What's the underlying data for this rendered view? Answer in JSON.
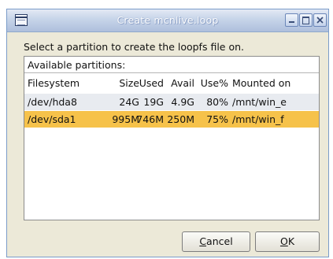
{
  "window": {
    "title": "Create mcnlive.loop"
  },
  "dialog": {
    "instruction": "Select a partition to create the loopfs file on.",
    "list_title": "Available partitions:",
    "columns": {
      "filesystem": "Filesystem",
      "size": "Size",
      "used": "Used",
      "avail": "Avail",
      "use_pct": "Use%",
      "mounted_on": "Mounted on"
    },
    "rows": [
      {
        "filesystem": "/dev/hda8",
        "size": "24G",
        "used": "19G",
        "avail": "4.9G",
        "use_pct": "80%",
        "mounted_on": "/mnt/win_e",
        "selected": false
      },
      {
        "filesystem": "/dev/sda1",
        "size": "995M",
        "used": "746M",
        "avail": "250M",
        "use_pct": "75%",
        "mounted_on": "/mnt/win_f",
        "selected": true
      }
    ],
    "buttons": {
      "cancel_mnemonic": "C",
      "cancel_rest": "ancel",
      "ok_mnemonic": "O",
      "ok_rest": "K"
    }
  },
  "colors": {
    "selection": "#f6c24a",
    "alt_row": "#e8ebf0",
    "dialog_bg": "#ece9d8"
  },
  "icons": {
    "app": "window-app-icon",
    "minimize": "minimize-icon",
    "maximize": "maximize-icon",
    "close": "close-icon"
  }
}
